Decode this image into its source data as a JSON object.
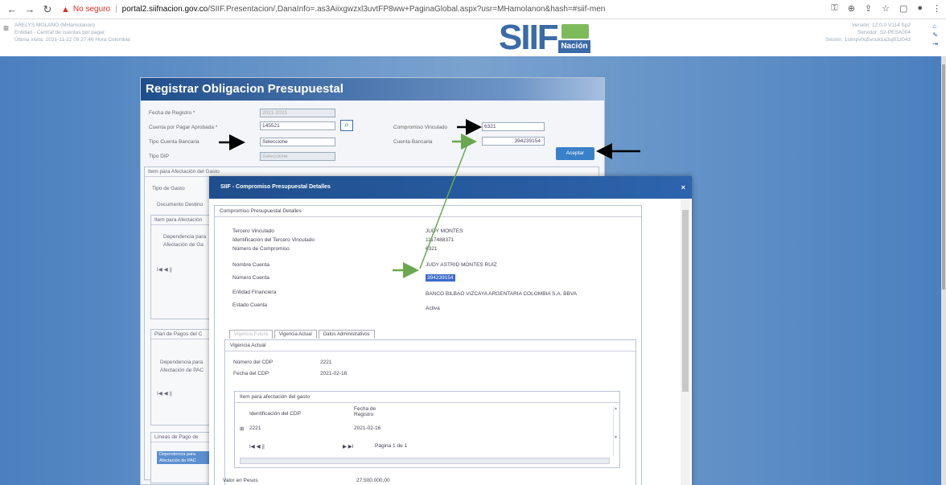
{
  "browser": {
    "not_secure": "No seguro",
    "url_host": "portal2.siifnacion.gov.co",
    "url_path": "/SIIF.Presentacion/,DanaInfo=.as3Aiixgwzxl3uvtFP8ww+PaginaGlobal.aspx?usr=MHamolanon&hash=#siif-menu"
  },
  "header": {
    "user_line1": "ARELYS MOLANO (MHamolanon)",
    "user_line2": "Entidad - Central de cuentas por pagar",
    "user_line3": "Última visita: 2021-11-22 09:27:46 Hora Colombia",
    "logo_text": "SIIF",
    "logo_sub": "Nación",
    "server_line1": "Versión: 12.0.0 V114 Sp2",
    "server_line2": "Servidor: S2-PESA004",
    "server_line3": "Sesión: 1stmpv0q5vcuk1a3uj01z043"
  },
  "register": {
    "title": "Registrar Obligacion Presupuestal",
    "fecha_label": "Fecha de Registro *",
    "fecha_value": "2021-2021",
    "cuenta_label": "Cuenta por Pagar Aprobada *",
    "cuenta_value": "145521",
    "tipo_cuenta_label": "Tipo Cuenta Bancaria",
    "tipo_cuenta_value": "Seleccione",
    "tipo_dp_label": "Tipo DIP",
    "tipo_dp_value": "Seleccione",
    "compromiso_label": "Compromiso Vinculado",
    "compromiso_value": "6321",
    "cuenta_bancaria_label": "Cuenta Bancaria",
    "cuenta_bancaria_value": "394239154",
    "accept_label": "Aceptar",
    "item_section": "Item para Afectación del Gasto",
    "tipo_gasto": "Tipo de Gasto",
    "documento": "Documento Destino",
    "item_sub": "Item para Afectación",
    "dependencia": "Dependencia para",
    "afectacion": "Afectación de Ga",
    "plan_pagos": "Plan de Pagos del C",
    "dep_pac": "Dependencia para",
    "afect_pac": "Afectación de PAC",
    "lineas": "Líneas de Pago de",
    "dep_hdr": "Dependencia para",
    "afect_hdr": "Afectación de PAC",
    "pager": "I◀ ◀ ||"
  },
  "modal": {
    "title": "SIIF - Compromiso Presupuestal Detalles",
    "close": "×",
    "panel_title": "Compromiso Presupuestal Detalles",
    "rows": [
      {
        "label": "Tercero Vinculado",
        "value": "JUDY MONTES"
      },
      {
        "label": "Identificación del Tercero Vinculado",
        "value": "1117488371"
      },
      {
        "label": "Número de Compromiso",
        "value": "6321"
      },
      {
        "label": "Nombre Cuenta",
        "value": "JUDY ASTRID MONTES RUIZ"
      },
      {
        "label": "Número Cuenta",
        "value": "394239154"
      },
      {
        "label": "Entidad Financiera",
        "value": "BANCO BILBAO VIZCAYA ARGENTARIA COLOMBIA S.A. BBVA"
      },
      {
        "label": "Estado Cuenta",
        "value": "Activa"
      }
    ],
    "tabs": [
      "Vigencia Futura",
      "Vigencia Actual",
      "Datos Administrativos"
    ],
    "vig_title": "Vigencia Actual",
    "cdp_label": "Número del CDP",
    "cdp_value": "2221",
    "fecha_cdp_label": "Fecha del CDP",
    "fecha_cdp_value": "2021-02-16",
    "grid_title": "Item para afectación del gasto",
    "col1": "Identificación del CDP",
    "col2": "Fecha de Registro",
    "row_id": "2221",
    "row_fecha": "2021-02-16",
    "pager_left": "I◀ ◀ ||",
    "pager_right": "▶ ▶I",
    "pager_text": "Página 1 de 1",
    "valor_label": "Valor en Pesos",
    "valor_value": "27.500.000,00"
  },
  "colors": {
    "arrow_black": "#000000",
    "arrow_green": "#6aa84f",
    "brand": "#1f4e8c"
  }
}
